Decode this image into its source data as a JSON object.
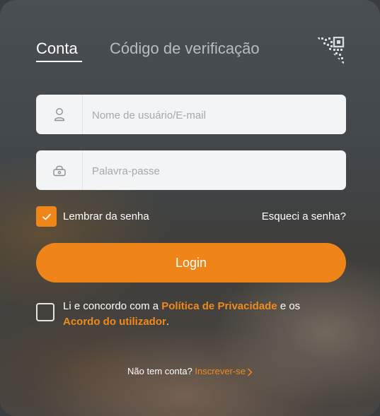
{
  "tabs": {
    "account": "Conta",
    "verification": "Código de verificação"
  },
  "icons": {
    "qr_corner": "qr-code-corner-icon",
    "username": "user-icon",
    "password": "lock-icon",
    "check": "checkmark-icon",
    "chevron": "chevron-right-icon"
  },
  "form": {
    "username_placeholder": "Nome de usuário/E-mail",
    "password_placeholder": "Palavra-passe",
    "remember_label": "Lembrar da senha",
    "remember_checked": true,
    "forgot_link": "Esqueci a senha?",
    "login_button": "Login"
  },
  "agreement": {
    "checked": false,
    "prefix": "Li e concordo com a ",
    "privacy_link": "Política de Privacidade",
    "middle": " e os",
    "user_agreement_link": "Acordo do utilizador",
    "suffix": "."
  },
  "signup": {
    "prompt": "Não tem conta? ",
    "link": "Inscrever-se"
  },
  "colors": {
    "accent": "#ef8518",
    "link": "#f08a1e",
    "field_bg": "#f2f4f6"
  }
}
